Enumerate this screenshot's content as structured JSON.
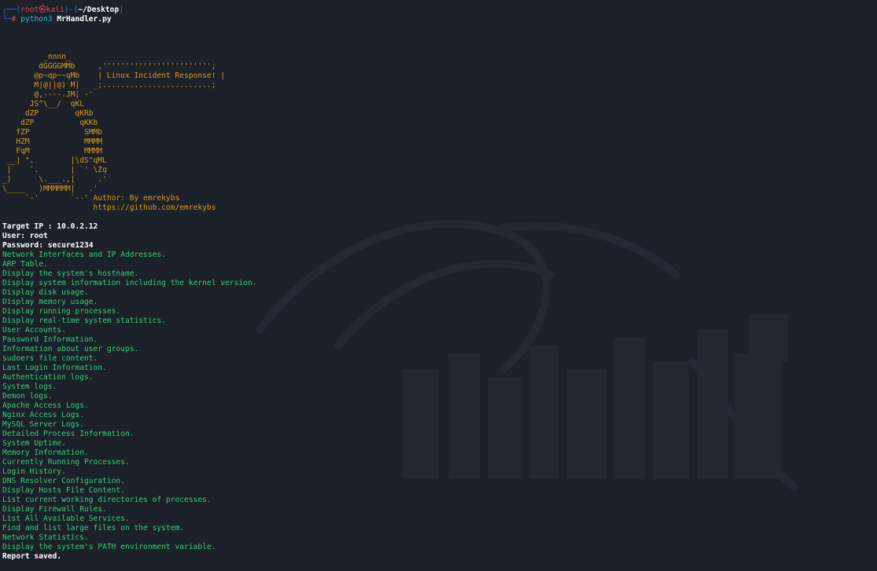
{
  "prompt": {
    "user_host": "root㉿kali",
    "path": "~/Desktop",
    "command": "python3",
    "argument": "MrHandler.py"
  },
  "banner": {
    "art_lines": [
      "         _nnnn_",
      "        dGGGGMMb     ,'''''''''''''''''''''''';",
      "       @p~qp~~qMb    | Linux Incident Response! |",
      "       M|@||@) M|   _;........................;",
      "       @,----.JM| -'",
      "      JS^\\__/  qKL",
      "     dZP        qKRb",
      "    dZP          qKKb",
      "   fZP            SMMb",
      "   HZM            MMMM",
      "   FqM            MMMM",
      " __| \".        |\\dS\"qML",
      " |    `.       | `' \\Zq",
      "_)      \\.___.,|     .'",
      "\\____   )MMMMMM|   .'",
      "     `-'       `--' Author: By emrekybs",
      "                    https://github.com/emrekybs"
    ]
  },
  "target": {
    "ip_line": "Target IP : 10.0.2.12",
    "user_line": "User: root",
    "password_line": "Password: secure1234"
  },
  "tasks": [
    "Network Interfaces and IP Addresses.",
    "ARP Table.",
    "Display the system's hostname.",
    "Display system information including the kernel version.",
    "Display disk usage.",
    "Display memory usage.",
    "Display running processes.",
    "Display real-time system statistics.",
    "User Accounts.",
    "Password Information.",
    "Information about user groups.",
    "sudoers file content.",
    "Last Login Information.",
    "Authentication logs.",
    "System logs.",
    "Demon logs.",
    "Apache Access Logs.",
    "Nginx Access Logs.",
    "MySQL Server Logs.",
    "Detailed Process Information.",
    "System Uptime.",
    "Memory Information.",
    "Currently Running Processes.",
    "Login History.",
    "DNS Resolver Configuration.",
    "Display Hosts File Content.",
    "List current working directories of processes.",
    "Display Firewall Rules.",
    "List All Available Services.",
    "Find and list large files on the system.",
    "Network Statistics.",
    "Display the system's PATH environment variable."
  ],
  "status": "Report saved.",
  "colors": {
    "background": "#1c2028",
    "prompt_frame": "#2f6fd6",
    "prompt_user": "#e0445a",
    "command": "#2fb3d3",
    "banner": "#d79b1d",
    "task_text": "#2fd17a",
    "plain_text": "#ffffff"
  },
  "icons": {
    "watermark": "kali-dragon-watermark-icon"
  }
}
